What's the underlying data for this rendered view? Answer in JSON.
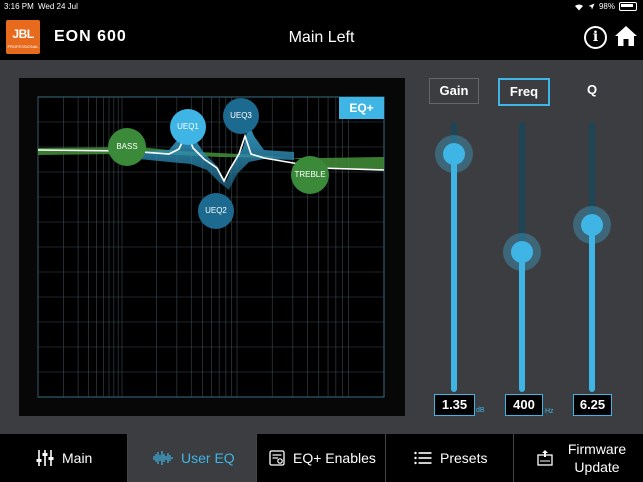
{
  "status": {
    "time": "3:16 PM",
    "date": "Wed 24 Jul",
    "battery": "98%"
  },
  "header": {
    "logo_text": "JBL",
    "logo_sub": "PROFESSIONAL",
    "brand": "EON 600",
    "title": "Main Left"
  },
  "eq": {
    "eqplus_label": "EQ+",
    "nodes": {
      "bass": "BASS",
      "ueq1": "UEQ1",
      "ueq2": "UEQ2",
      "ueq3": "UEQ3",
      "treble": "TREBLE"
    }
  },
  "sliders": {
    "gain": {
      "label": "Gain",
      "value": "1.35",
      "unit": "dB",
      "level": 0.88
    },
    "freq": {
      "label": "Freq",
      "value": "400",
      "unit": "Hz",
      "level": 0.52
    },
    "q": {
      "label": "Q",
      "value": "6.25",
      "unit": "",
      "level": 0.62
    }
  },
  "tabs": {
    "main": "Main",
    "user_eq": "User EQ",
    "eq_enables": "EQ+ Enables",
    "presets": "Presets",
    "firmware": "Firmware Update"
  },
  "colors": {
    "accent": "#3eb5e5",
    "jbl_orange": "#e86a1c",
    "bass_green": "#3a8a3a"
  }
}
